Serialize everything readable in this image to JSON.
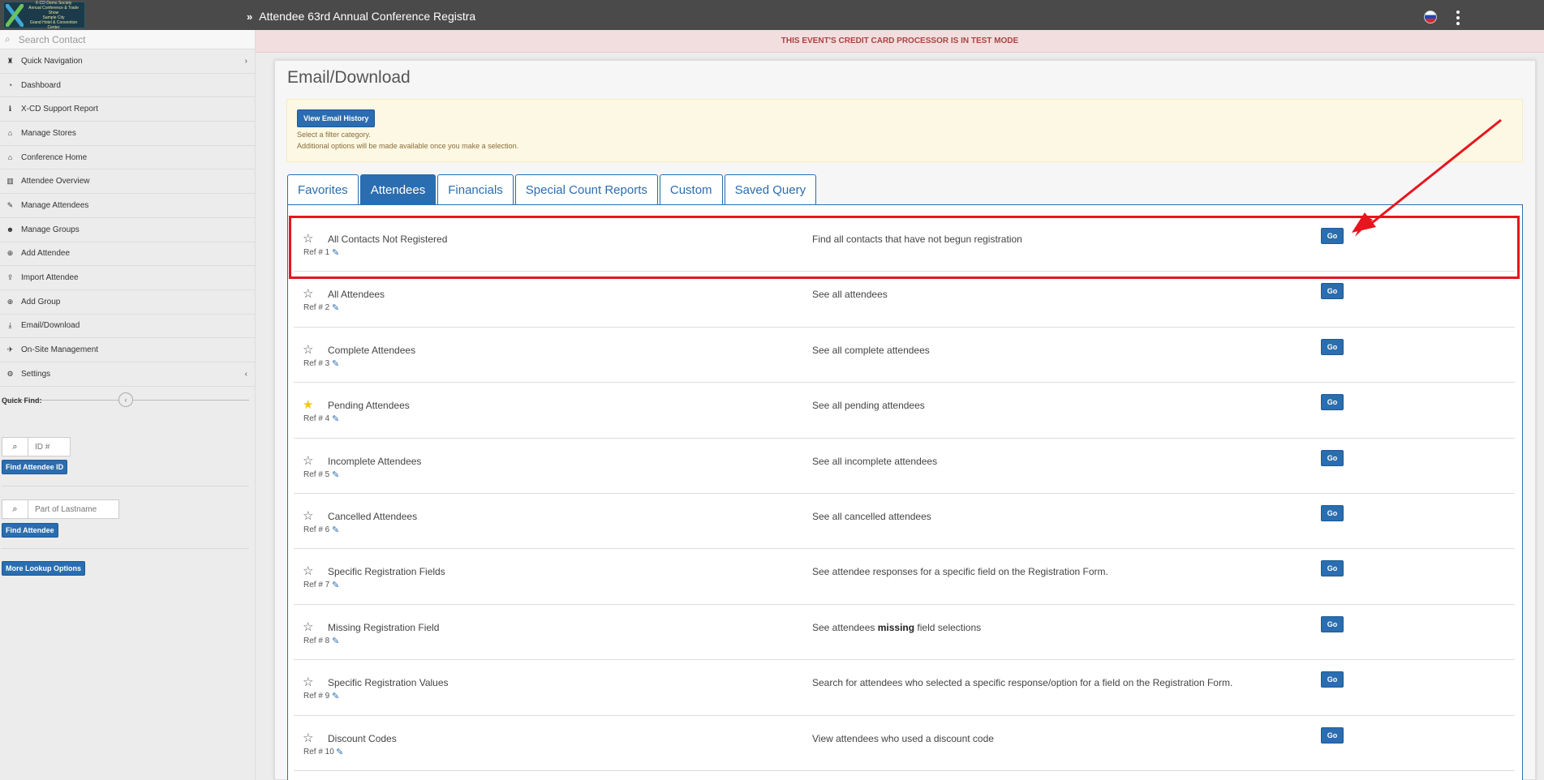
{
  "header": {
    "logo_text": [
      "X-CD Demo Society",
      "Annual Conference & Trade Show",
      "Sample City",
      "Grand Hotel & Convention Center"
    ],
    "title": "Attendee 63rd Annual Conference Registra"
  },
  "sidebar": {
    "search_placeholder": "Search Contact",
    "items": [
      {
        "label": "Quick Navigation",
        "icon": "binoculars-icon",
        "glyph": "♜",
        "arrow": "›"
      },
      {
        "label": "Dashboard",
        "icon": "dashboard-icon",
        "glyph": "◔"
      },
      {
        "label": "X-CD Support Report",
        "icon": "info-icon",
        "glyph": "ℹ"
      },
      {
        "label": "Manage Stores",
        "icon": "home-icon",
        "glyph": "⌂"
      },
      {
        "label": "Conference Home",
        "icon": "home-icon",
        "glyph": "⌂"
      },
      {
        "label": "Attendee Overview",
        "icon": "bar-chart-icon",
        "glyph": "▥"
      },
      {
        "label": "Manage Attendees",
        "icon": "edit-icon",
        "glyph": "✎"
      },
      {
        "label": "Manage Groups",
        "icon": "users-icon",
        "glyph": "☻"
      },
      {
        "label": "Add Attendee",
        "icon": "plus-circle-icon",
        "glyph": "⊕"
      },
      {
        "label": "Import Attendee",
        "icon": "upload-icon",
        "glyph": "⇪"
      },
      {
        "label": "Add Group",
        "icon": "plus-circle-icon",
        "glyph": "⊕"
      },
      {
        "label": "Email/Download",
        "icon": "download-icon",
        "glyph": "⤓"
      },
      {
        "label": "On-Site Management",
        "icon": "plane-icon",
        "glyph": "✈"
      },
      {
        "label": "Settings",
        "icon": "gears-icon",
        "glyph": "⚙",
        "arrow": "‹"
      }
    ],
    "quick_find_label": "Quick Find:",
    "id_placeholder": "ID #",
    "find_id_button": "Find Attendee ID",
    "lastname_placeholder": "Part of Lastname",
    "find_attendee_button": "Find Attendee",
    "more_lookup_button": "More Lookup Options"
  },
  "alert": "THIS EVENT'S CREDIT CARD PROCESSOR IS IN TEST MODE",
  "main": {
    "title": "Email/Download",
    "view_history_button": "View Email History",
    "info_line1": "Select a filter category.",
    "info_line2": "Additional options will be made available once you make a selection.",
    "tabs": [
      {
        "label": "Favorites",
        "active": false
      },
      {
        "label": "Attendees",
        "active": true
      },
      {
        "label": "Financials",
        "active": false
      },
      {
        "label": "Special Count Reports",
        "active": false
      },
      {
        "label": "Custom",
        "active": false
      },
      {
        "label": "Saved Query",
        "active": false
      }
    ],
    "go_label": "Go",
    "rows": [
      {
        "name": "All Contacts Not Registered",
        "ref": "Ref # 1",
        "desc": "Find all contacts that have not begun registration",
        "starred": false
      },
      {
        "name": "All Attendees",
        "ref": "Ref # 2",
        "desc": "See all attendees",
        "starred": false
      },
      {
        "name": "Complete Attendees",
        "ref": "Ref # 3",
        "desc": "See all complete attendees",
        "starred": false
      },
      {
        "name": "Pending Attendees",
        "ref": "Ref # 4",
        "desc": "See all pending attendees",
        "starred": true
      },
      {
        "name": "Incomplete Attendees",
        "ref": "Ref # 5",
        "desc": "See all incomplete attendees",
        "starred": false
      },
      {
        "name": "Cancelled Attendees",
        "ref": "Ref # 6",
        "desc": "See all cancelled attendees",
        "starred": false
      },
      {
        "name": "Specific Registration Fields",
        "ref": "Ref # 7",
        "desc": "See attendee responses for a specific field on the Registration Form.",
        "starred": false
      },
      {
        "name": "Missing Registration Field",
        "ref": "Ref # 8",
        "desc_pre": "See attendees ",
        "desc_bold": "missing",
        "desc_post": " field selections",
        "starred": false
      },
      {
        "name": "Specific Registration Values",
        "ref": "Ref # 9",
        "desc": "Search for attendees who selected a specific response/option for a field on the Registration Form.",
        "starred": false
      },
      {
        "name": "Discount Codes",
        "ref": "Ref # 10",
        "desc": "View attendees who used a discount code",
        "starred": false
      }
    ]
  },
  "colors": {
    "primary": "#2a6db0",
    "topbar": "#4a4a4a",
    "alert_text": "#a94442",
    "annotation": "#e8141e",
    "star_on": "#f3c613"
  }
}
